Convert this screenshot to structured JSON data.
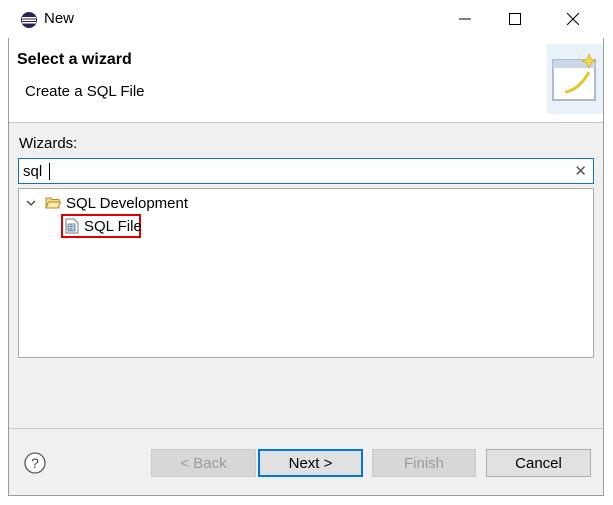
{
  "window": {
    "title": "New"
  },
  "header": {
    "title": "Select a wizard",
    "subtitle": "Create a SQL File"
  },
  "wizards": {
    "label": "Wizards:",
    "filter_value": "sql",
    "tree": [
      {
        "label": "SQL Development",
        "expanded": true,
        "icon": "folder-open-icon",
        "children": [
          {
            "label": "SQL File",
            "icon": "sql-file-icon",
            "selected": true
          }
        ]
      }
    ]
  },
  "buttons": {
    "back": "< Back",
    "next": "Next >",
    "finish": "Finish",
    "cancel": "Cancel"
  },
  "colors": {
    "accent": "#0078d7",
    "highlight": "#e00000"
  }
}
